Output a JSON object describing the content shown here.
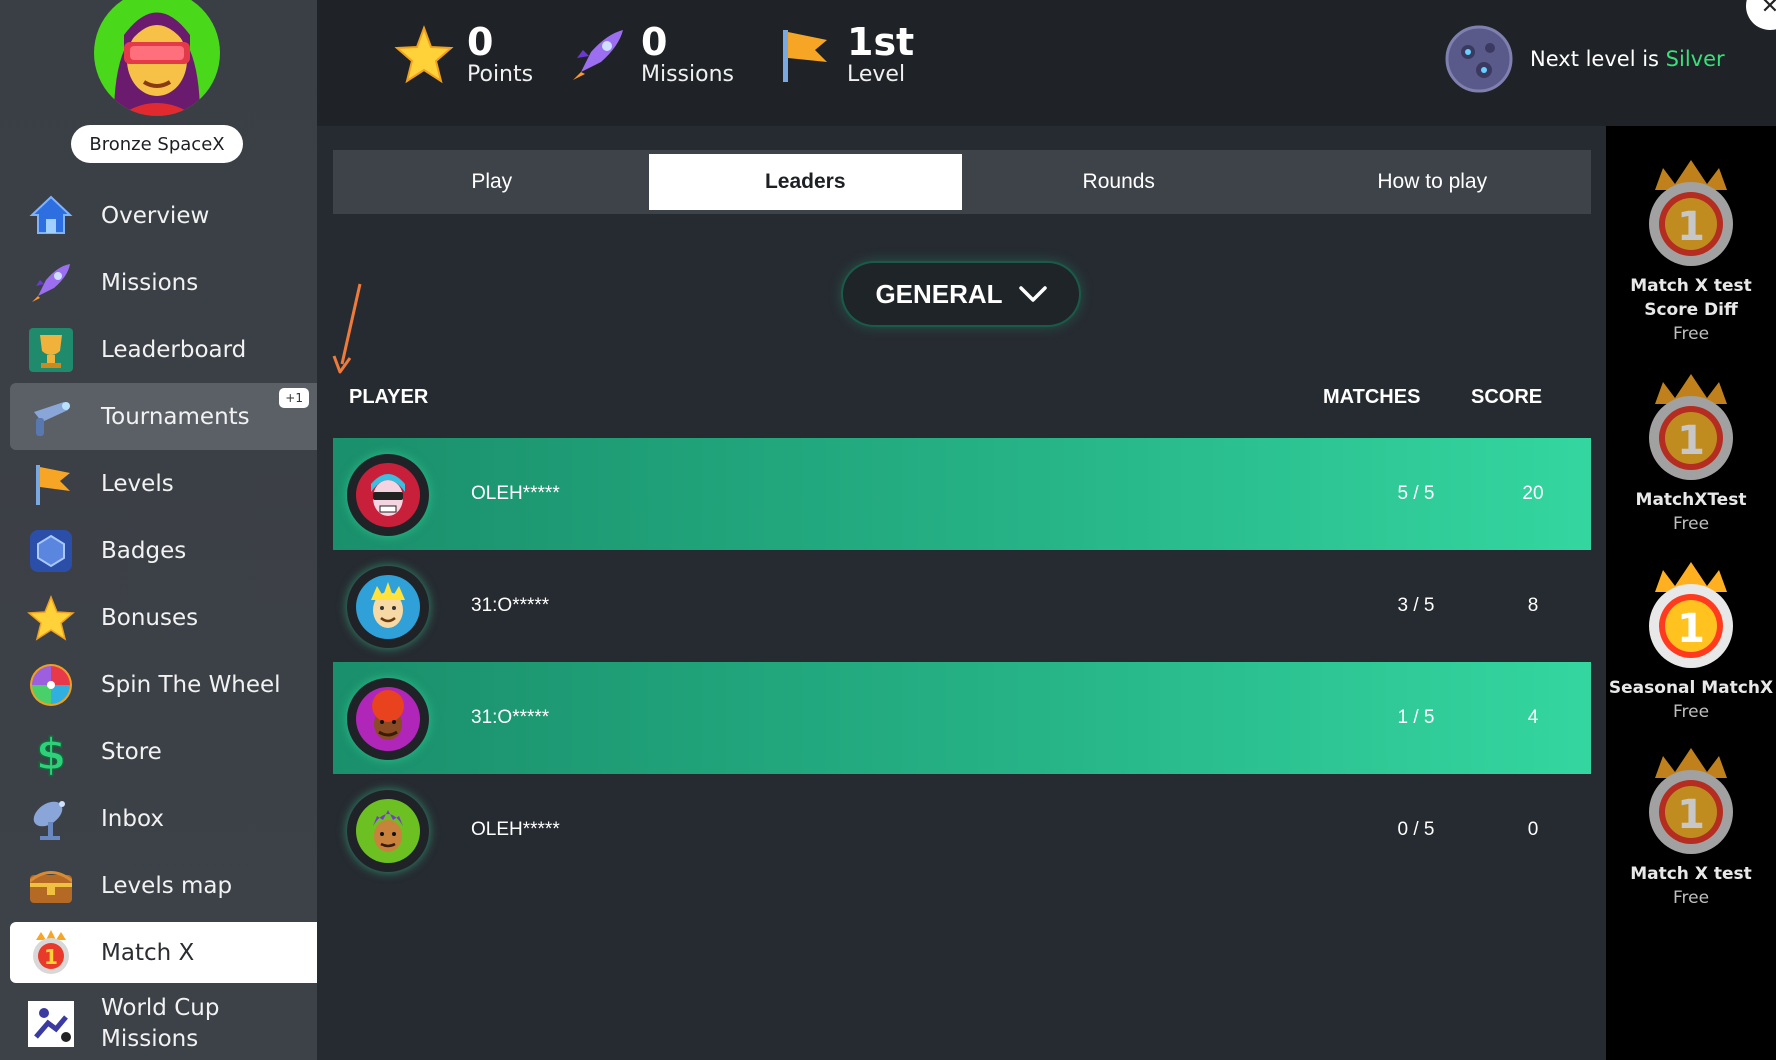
{
  "user": {
    "rank_label": "Bronze SpaceX"
  },
  "sidebar": {
    "items": [
      {
        "label": "Overview",
        "icon": "house-icon"
      },
      {
        "label": "Missions",
        "icon": "rocket-icon"
      },
      {
        "label": "Leaderboard",
        "icon": "trophy-icon"
      },
      {
        "label": "Tournaments",
        "icon": "raygun-icon",
        "badge": "+1"
      },
      {
        "label": "Levels",
        "icon": "flag-icon"
      },
      {
        "label": "Badges",
        "icon": "shield-icon"
      },
      {
        "label": "Bonuses",
        "icon": "star-icon"
      },
      {
        "label": "Spin The Wheel",
        "icon": "wheel-icon"
      },
      {
        "label": "Store",
        "icon": "dollar-icon"
      },
      {
        "label": "Inbox",
        "icon": "satellite-icon"
      },
      {
        "label": "Levels map",
        "icon": "chest-icon"
      },
      {
        "label": "Match X",
        "icon": "medal-icon"
      },
      {
        "label": "World Cup\nMissions",
        "icon": "soccer-icon"
      }
    ]
  },
  "stats": {
    "points": {
      "value": "0",
      "label": "Points"
    },
    "missions": {
      "value": "0",
      "label": "Missions"
    },
    "level": {
      "value": "1st",
      "label": "Level"
    }
  },
  "next_level": {
    "prefix": "Next level is ",
    "name": "Silver"
  },
  "tabs": [
    "Play",
    "Leaders",
    "Rounds",
    "How to play"
  ],
  "active_tab": "Leaders",
  "filter": {
    "selected": "GENERAL"
  },
  "table": {
    "headers": {
      "player": "PLAYER",
      "matches": "MATCHES",
      "score": "SCORE"
    },
    "rows": [
      {
        "name": "OLEH*****",
        "matches": "5 / 5",
        "score": "20",
        "highlight": true,
        "avatar_color": "#c8203a"
      },
      {
        "name": "31:O*****",
        "matches": "3 / 5",
        "score": "8",
        "highlight": false,
        "avatar_color": "#2fa0d8"
      },
      {
        "name": "31:O*****",
        "matches": "1 / 5",
        "score": "4",
        "highlight": true,
        "avatar_color": "#b026b8"
      },
      {
        "name": "OLEH*****",
        "matches": "0 / 5",
        "score": "0",
        "highlight": false,
        "avatar_color": "#6cc022"
      }
    ]
  },
  "tournaments": [
    {
      "name": "Match X test Score Diff",
      "price": "Free",
      "active": false
    },
    {
      "name": "MatchXTest",
      "price": "Free",
      "active": false
    },
    {
      "name": "Seasonal MatchX",
      "price": "Free",
      "active": true
    },
    {
      "name": "Match X test",
      "price": "Free",
      "active": false
    }
  ],
  "colors": {
    "accent_green": "#39e07a",
    "row_highlight": "#26b386",
    "rail_bg": "#000000"
  }
}
